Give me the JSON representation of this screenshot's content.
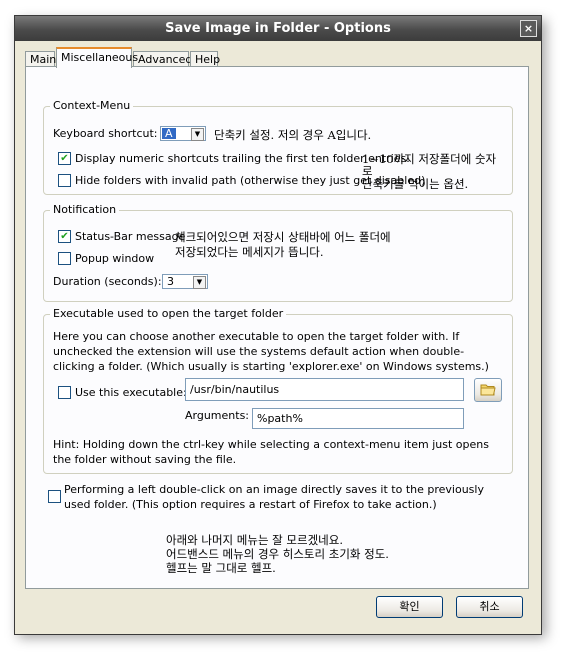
{
  "window": {
    "title": "Save Image in Folder - Options",
    "close_glyph": "×"
  },
  "tabs": [
    {
      "label": "Main"
    },
    {
      "label": "Miscellaneous"
    },
    {
      "label": "Advanced"
    },
    {
      "label": "Help"
    }
  ],
  "context_menu": {
    "legend": "Context-Menu",
    "shortcut_label": "Keyboard shortcut:",
    "shortcut_value": "A",
    "display_numeric": {
      "label": "Display numeric shortcuts trailing the first ten folder entries.",
      "checked": true
    },
    "hide_folders": {
      "label": "Hide folders with invalid path (otherwise they just get disabled)",
      "checked": false
    }
  },
  "notification": {
    "legend": "Notification",
    "statusbar": {
      "label": "Status-Bar message",
      "checked": true
    },
    "popup": {
      "label": "Popup window",
      "checked": false
    },
    "duration_label": "Duration (seconds):",
    "duration_value": "3"
  },
  "executable": {
    "legend": "Executable used to open the target folder",
    "description": "Here you can choose another executable to open the target folder with. If unchecked the extension will use the systems default action when double-clicking a folder. (Which usually is starting 'explorer.exe' on Windows systems.)",
    "use_exec": {
      "label": "Use this executable:",
      "checked": false
    },
    "path_value": "/usr/bin/nautilus",
    "arguments_label": "Arguments:",
    "arguments_value": "%path%",
    "hint": "Hint: Holding down the ctrl-key while selecting a context-menu item just opens the folder without saving the file."
  },
  "doubleclick": {
    "label": "Performing a left double-click on an image directly saves it to the previously used folder. (This option requires a restart of Firefox to take action.)",
    "checked": false
  },
  "annotations": {
    "shortcut_note": "단축키 설정. 저의 경우 A입니다.",
    "numeric_note_1": "1~10까지 저장폴더에 숫자",
    "numeric_note_2": "로",
    "numeric_note_3": "단축키를 먹이는 옵션.",
    "statusbar_note_1": "체크되어있으면 저장시 상태바에 어느 폴더에",
    "statusbar_note_2": "저장되었다는 메세지가 뜹니다.",
    "bottom_note_1": "아래와 나머지 메뉴는 잘 모르겠네요.",
    "bottom_note_2": "어드밴스드 메뉴의 경우 히스토리 초기화 정도.",
    "bottom_note_3": "헬프는 말 그대로 헬프."
  },
  "buttons": {
    "ok": "확인",
    "cancel": "취소"
  },
  "icons": {
    "folder": "folder-icon",
    "check": "✔"
  }
}
